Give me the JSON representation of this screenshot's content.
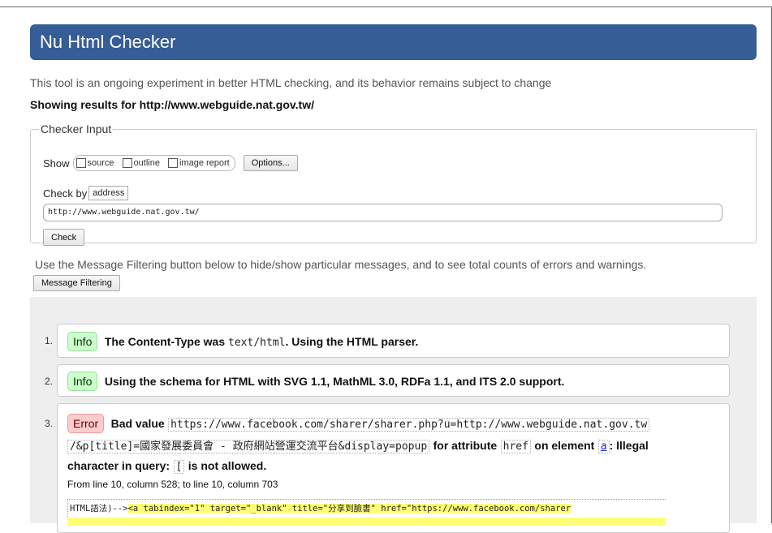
{
  "app": {
    "title": "Nu Html Checker",
    "intro": "This tool is an ongoing experiment in better HTML checking, and its behavior remains subject to change",
    "showing": "Showing results for http://www.webguide.nat.gov.tw/"
  },
  "checker": {
    "legend": "Checker Input",
    "show_label": "Show",
    "options": [
      {
        "label": "source",
        "checked": false
      },
      {
        "label": "outline",
        "checked": false
      },
      {
        "label": "image report",
        "checked": false
      }
    ],
    "options_button": "Options...",
    "check_by_label": "Check by",
    "check_by_value": "address",
    "url_value": "http://www.webguide.nat.gov.tw/",
    "check_button": "Check"
  },
  "filter": {
    "text": "Use the Message Filtering button below to hide/show particular messages, and to see total counts of errors and warnings.",
    "button": "Message Filtering"
  },
  "messages": [
    {
      "number": "1.",
      "type": "Info",
      "text_before": "The Content-Type was",
      "code": "text/html",
      "text_after": ". Using the HTML parser."
    },
    {
      "number": "2.",
      "type": "Info",
      "text": "Using the schema for HTML with SVG 1.1, MathML 3.0, RDFa 1.1, and ITS 2.0 support."
    },
    {
      "number": "3.",
      "type": "Error",
      "text_bad": "Bad value",
      "value_line1": "https://www.facebook.com/sharer/sharer.php?u=http://www.webguide.nat.gov.tw",
      "value_line2": "/&p[title]=國家發展委員會 - 政府網站營運交流平台&display=popup",
      "for_attr": "for attribute",
      "attr": "href",
      "on_element": "on element",
      "element": "a",
      "illegal": ": Illegal",
      "char_in_query": "character in query:",
      "char": "[",
      "not_allowed": "is not allowed.",
      "location": "From line 10, column 528; to line 10, column 703",
      "extract_prefix": "HTML語法)-->",
      "extract_highlight": "<a tabindex=\"1\" target=\"_blank\" title=\"分享到臉書\" href=\"https://www.facebook.com/sharer"
    }
  ],
  "colors": {
    "banner": "#365d95",
    "info_badge": "#ccffcc",
    "error_badge": "#ffcccc",
    "highlight": "#ffff77"
  }
}
